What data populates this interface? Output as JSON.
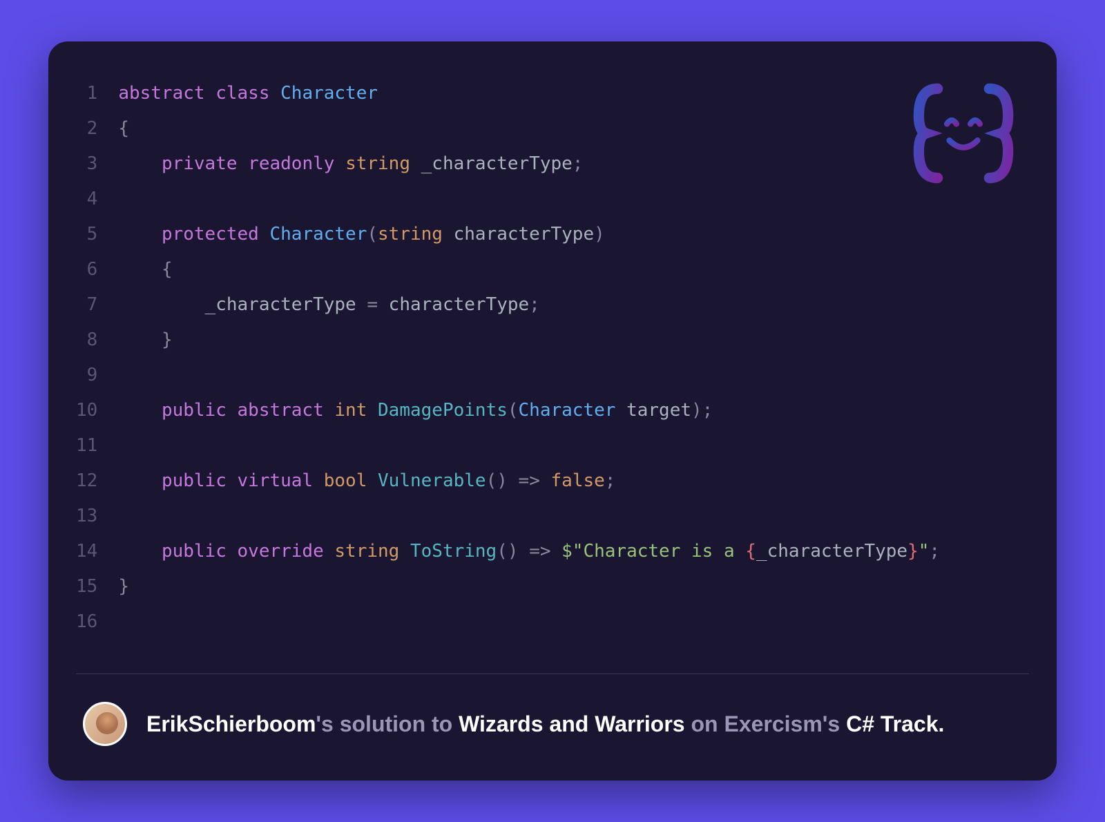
{
  "code": {
    "lines": [
      [
        {
          "t": "abstract",
          "c": "tok-kw"
        },
        {
          "t": " "
        },
        {
          "t": "class",
          "c": "tok-kw"
        },
        {
          "t": " "
        },
        {
          "t": "Character",
          "c": "tok-cls"
        }
      ],
      [
        {
          "t": "{",
          "c": "tok-punc"
        }
      ],
      [
        {
          "t": "    "
        },
        {
          "t": "private",
          "c": "tok-kw"
        },
        {
          "t": " "
        },
        {
          "t": "readonly",
          "c": "tok-kw"
        },
        {
          "t": " "
        },
        {
          "t": "string",
          "c": "tok-type"
        },
        {
          "t": " "
        },
        {
          "t": "_characterType",
          "c": "tok-ident"
        },
        {
          "t": ";",
          "c": "tok-punc"
        }
      ],
      [
        {
          "t": ""
        }
      ],
      [
        {
          "t": "    "
        },
        {
          "t": "protected",
          "c": "tok-kw"
        },
        {
          "t": " "
        },
        {
          "t": "Character",
          "c": "tok-cls"
        },
        {
          "t": "(",
          "c": "tok-punc"
        },
        {
          "t": "string",
          "c": "tok-type"
        },
        {
          "t": " "
        },
        {
          "t": "characterType",
          "c": "tok-ident"
        },
        {
          "t": ")",
          "c": "tok-punc"
        }
      ],
      [
        {
          "t": "    "
        },
        {
          "t": "{",
          "c": "tok-punc"
        }
      ],
      [
        {
          "t": "        "
        },
        {
          "t": "_characterType",
          "c": "tok-ident"
        },
        {
          "t": " = ",
          "c": "tok-punc"
        },
        {
          "t": "characterType",
          "c": "tok-ident"
        },
        {
          "t": ";",
          "c": "tok-punc"
        }
      ],
      [
        {
          "t": "    "
        },
        {
          "t": "}",
          "c": "tok-punc"
        }
      ],
      [
        {
          "t": ""
        }
      ],
      [
        {
          "t": "    "
        },
        {
          "t": "public",
          "c": "tok-kw"
        },
        {
          "t": " "
        },
        {
          "t": "abstract",
          "c": "tok-kw"
        },
        {
          "t": " "
        },
        {
          "t": "int",
          "c": "tok-type"
        },
        {
          "t": " "
        },
        {
          "t": "DamagePoints",
          "c": "tok-fn"
        },
        {
          "t": "(",
          "c": "tok-punc"
        },
        {
          "t": "Character",
          "c": "tok-cls"
        },
        {
          "t": " "
        },
        {
          "t": "target",
          "c": "tok-ident"
        },
        {
          "t": ")",
          "c": "tok-punc"
        },
        {
          "t": ";",
          "c": "tok-punc"
        }
      ],
      [
        {
          "t": ""
        }
      ],
      [
        {
          "t": "    "
        },
        {
          "t": "public",
          "c": "tok-kw"
        },
        {
          "t": " "
        },
        {
          "t": "virtual",
          "c": "tok-kw"
        },
        {
          "t": " "
        },
        {
          "t": "bool",
          "c": "tok-type"
        },
        {
          "t": " "
        },
        {
          "t": "Vulnerable",
          "c": "tok-fn"
        },
        {
          "t": "()",
          "c": "tok-punc"
        },
        {
          "t": " "
        },
        {
          "t": "=>",
          "c": "tok-punc"
        },
        {
          "t": " "
        },
        {
          "t": "false",
          "c": "tok-bool"
        },
        {
          "t": ";",
          "c": "tok-punc"
        }
      ],
      [
        {
          "t": ""
        }
      ],
      [
        {
          "t": "    "
        },
        {
          "t": "public",
          "c": "tok-kw"
        },
        {
          "t": " "
        },
        {
          "t": "override",
          "c": "tok-kw"
        },
        {
          "t": " "
        },
        {
          "t": "string",
          "c": "tok-type"
        },
        {
          "t": " "
        },
        {
          "t": "ToString",
          "c": "tok-fn"
        },
        {
          "t": "()",
          "c": "tok-punc"
        },
        {
          "t": " "
        },
        {
          "t": "=>",
          "c": "tok-punc"
        },
        {
          "t": " "
        },
        {
          "t": "$\"",
          "c": "tok-str"
        },
        {
          "t": "Character is a ",
          "c": "tok-str"
        },
        {
          "t": "{",
          "c": "tok-interp"
        },
        {
          "t": "_characterType",
          "c": "tok-ident"
        },
        {
          "t": "}",
          "c": "tok-interp"
        },
        {
          "t": "\"",
          "c": "tok-str"
        },
        {
          "t": ";",
          "c": "tok-punc"
        }
      ],
      [
        {
          "t": "}",
          "c": "tok-punc"
        }
      ],
      [
        {
          "t": ""
        }
      ]
    ]
  },
  "footer": {
    "author": "ErikSchierboom",
    "possessive": "'s",
    "mid1": " solution to ",
    "exercise": "Wizards and Warriors",
    "mid2": " on Exercism's ",
    "track": "C# Track."
  }
}
